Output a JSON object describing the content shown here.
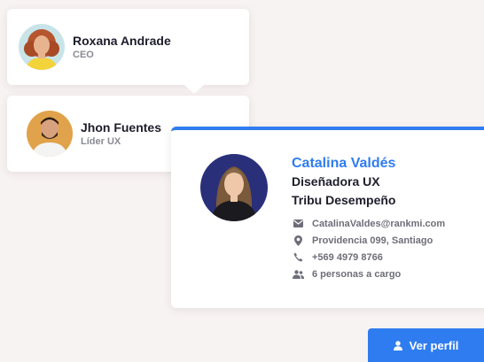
{
  "org_chart": {
    "manager": {
      "name": "Roxana Andrade",
      "role": "CEO",
      "avatar": "avatar-woman-curly-hair"
    },
    "employee": {
      "name": "Jhon Fuentes",
      "role": "Líder UX",
      "avatar": "avatar-man-beard"
    }
  },
  "profile": {
    "name": "Catalina Valdés",
    "title": "Diseñadora UX",
    "team": "Tribu Desempeño",
    "avatar": "avatar-woman-long-hair",
    "accent_color": "#2f7cf0",
    "info": [
      {
        "icon": "mail-icon",
        "text": "CatalinaValdes@rankmi.com"
      },
      {
        "icon": "location-pin-icon",
        "text": "Providencia 099, Santiago"
      },
      {
        "icon": "phone-icon",
        "text": "+569 4979 8766"
      },
      {
        "icon": "people-icon",
        "text": "6 personas a cargo"
      }
    ]
  },
  "actions": {
    "view_profile_label": "Ver perfil",
    "view_profile_icon": "user-icon"
  }
}
